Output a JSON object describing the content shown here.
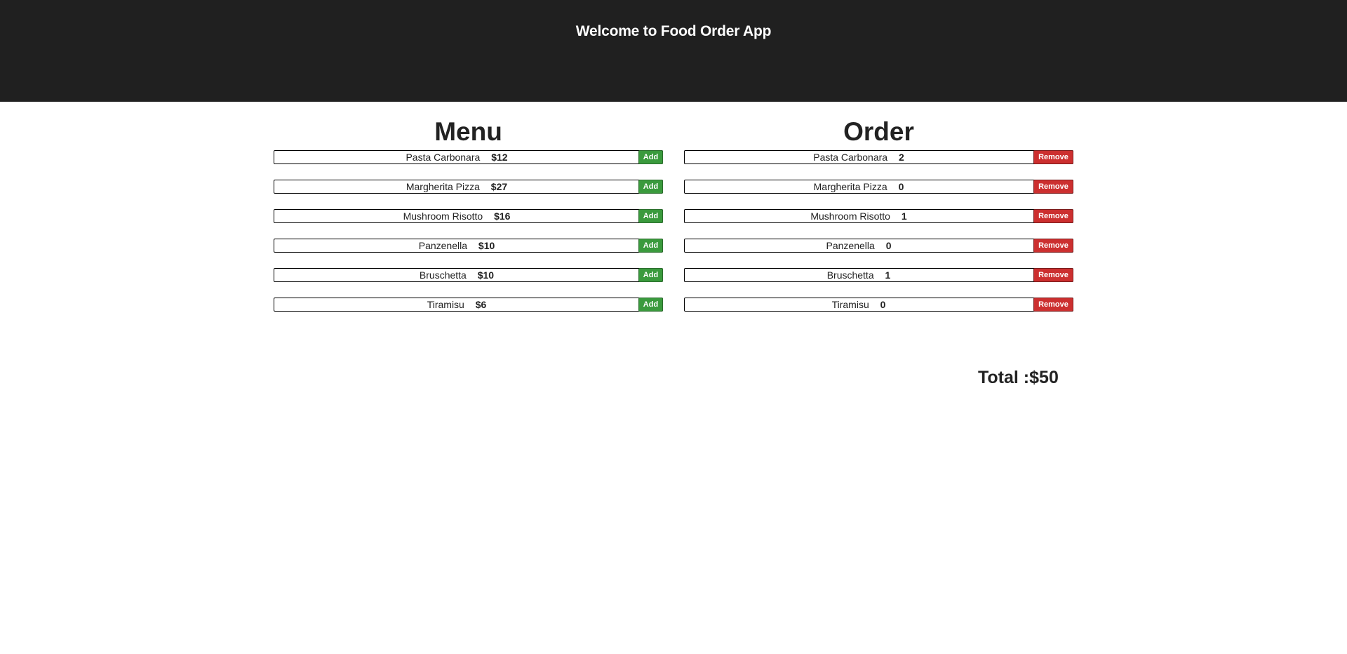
{
  "header": {
    "title": "Welcome to Food Order App"
  },
  "menu": {
    "title": "Menu",
    "add_label": "Add",
    "items": [
      {
        "name": "Pasta Carbonara",
        "price": "$12"
      },
      {
        "name": "Margherita Pizza",
        "price": "$27"
      },
      {
        "name": "Mushroom Risotto",
        "price": "$16"
      },
      {
        "name": "Panzenella",
        "price": "$10"
      },
      {
        "name": "Bruschetta",
        "price": "$10"
      },
      {
        "name": "Tiramisu",
        "price": "$6"
      }
    ]
  },
  "order": {
    "title": "Order",
    "remove_label": "Remove",
    "items": [
      {
        "name": "Pasta Carbonara",
        "quantity": "2"
      },
      {
        "name": "Margherita Pizza",
        "quantity": "0"
      },
      {
        "name": "Mushroom Risotto",
        "quantity": "1"
      },
      {
        "name": "Panzenella",
        "quantity": "0"
      },
      {
        "name": "Bruschetta",
        "quantity": "1"
      },
      {
        "name": "Tiramisu",
        "quantity": "0"
      }
    ]
  },
  "total": {
    "text": "Total :$50"
  },
  "colors": {
    "header_bg": "#202020",
    "add_button": "#3a9a3d",
    "remove_button": "#cc2f2f"
  }
}
